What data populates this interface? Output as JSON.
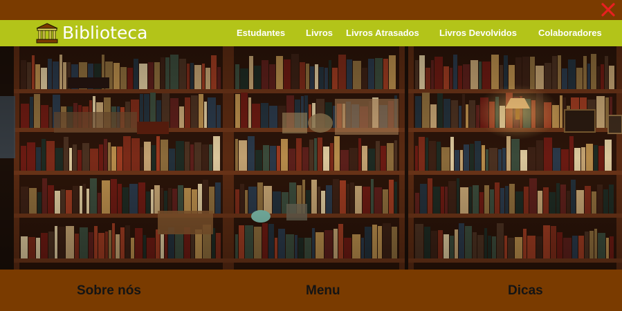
{
  "colors": {
    "header_bg": "#7a3b00",
    "nav_bg": "#b3c419",
    "footer_bg": "#7a3b00",
    "close_icon": "#e82020",
    "nav_text": "#ffffff",
    "footer_text": "#141414"
  },
  "header": {
    "close_icon": "close-icon"
  },
  "nav": {
    "brand_icon": "library-building-icon",
    "brand_name": "Biblioteca",
    "links": [
      "Estudantes",
      "Livros",
      "Livros Atrasados",
      "Livros Devolvidos",
      "Colaboradores"
    ]
  },
  "hero": {
    "image": "bookshelf-photo"
  },
  "footer": {
    "links": [
      "Sobre nós",
      "Menu",
      "Dicas"
    ]
  }
}
